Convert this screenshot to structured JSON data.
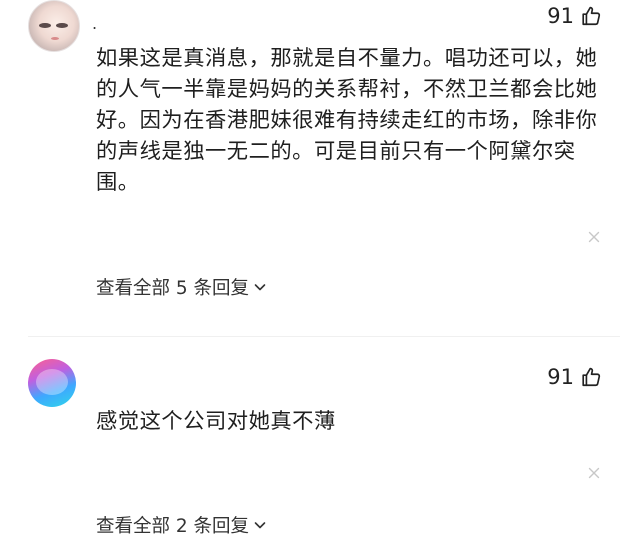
{
  "comments": [
    {
      "username": ".",
      "likes": "91",
      "text": "如果这是真消息，那就是自不量力。唱功还可以，她的人气一半靠是妈妈的关系帮衬，不然卫兰都会比她好。因为在香港肥妹很难有持续走红的市场，除非你的声线是独一无二的。可是目前只有一个阿黛尔突围。",
      "replies_link": "查看全部 5 条回复"
    },
    {
      "likes": "91",
      "text": "感觉这个公司对她真不薄",
      "replies_link": "查看全部 2 条回复"
    }
  ],
  "icons": {
    "like": "thumbs-up-icon",
    "close": "close-icon",
    "expand": "chevron-down-icon"
  },
  "colors": {
    "text": "#1f1f1f",
    "muted": "#c8c8c8"
  }
}
